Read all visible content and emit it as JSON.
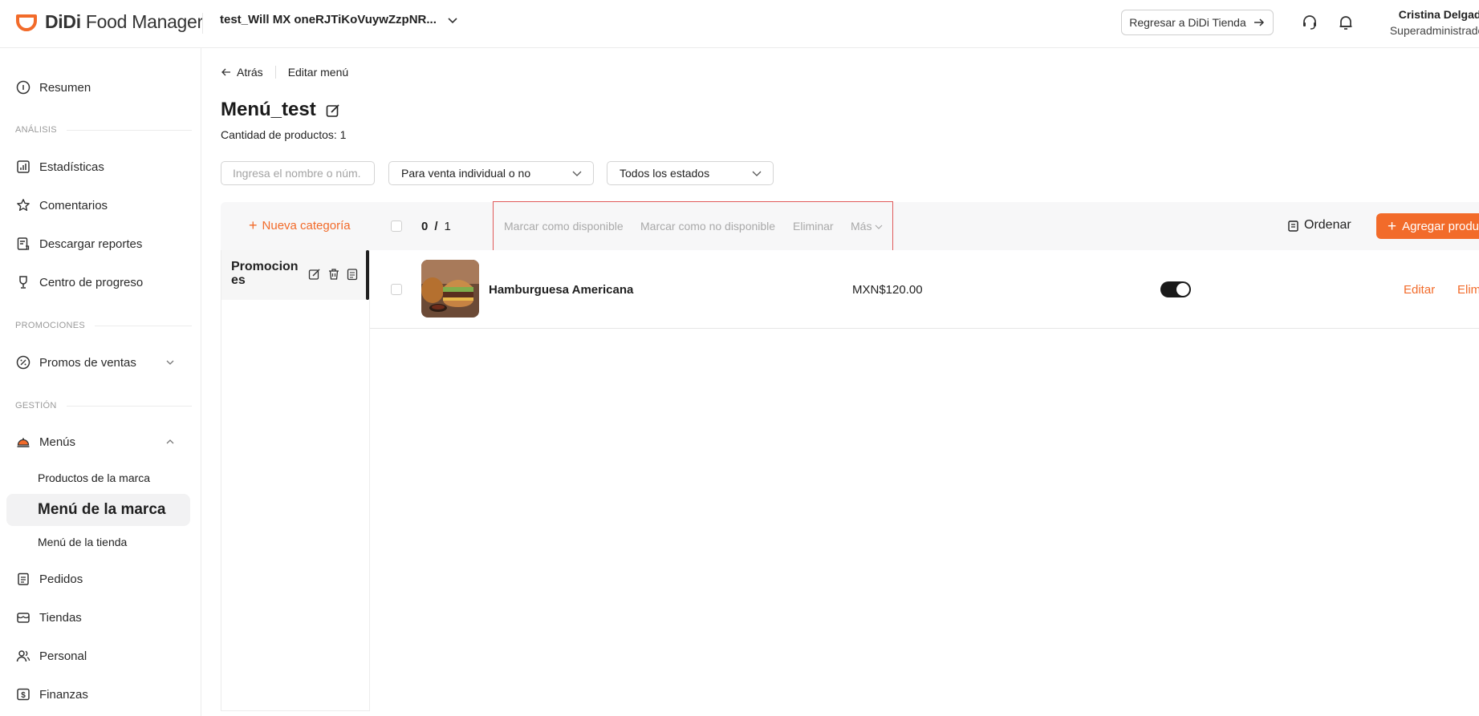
{
  "header": {
    "logo_brand": "DiDi",
    "logo_product": "Food Manager",
    "store_name": "test_Will MX oneRJTiKoVuywZzpNR...",
    "back_button": "Regresar a DiDi Tienda",
    "user_name": "Cristina Delgado",
    "user_role": "Superadministrador"
  },
  "sidebar": {
    "summary": "Resumen",
    "section_analysis": "ANÁLISIS",
    "stats": "Estadísticas",
    "comments": "Comentarios",
    "reports": "Descargar reportes",
    "progress": "Centro de progreso",
    "section_promos": "PROMOCIONES",
    "sales_promos": "Promos de ventas",
    "section_management": "GESTIÓN",
    "menus": "Menús",
    "brand_products": "Productos de la marca",
    "brand_menu": "Menú de la marca",
    "store_menu": "Menú de la tienda",
    "orders": "Pedidos",
    "stores": "Tiendas",
    "staff": "Personal",
    "finances": "Finanzas"
  },
  "breadcrumb": {
    "back": "Atrás",
    "current": "Editar menú"
  },
  "page": {
    "title": "Menú_test",
    "product_count": "Cantidad de productos: 1"
  },
  "filters": {
    "search_placeholder": "Ingresa el nombre o núm. d",
    "sale_type": "Para venta individual o no",
    "status": "Todos los estados"
  },
  "toolbar": {
    "new_category": "Nueva categoría",
    "selected": "0",
    "separator": "/",
    "total": "1",
    "mark_available": "Marcar como disponible",
    "mark_unavailable": "Marcar como no disponible",
    "delete": "Eliminar",
    "more": "Más",
    "sort": "Ordenar",
    "add_product": "Agregar producto"
  },
  "categories": [
    {
      "name": "Promociones"
    }
  ],
  "products": [
    {
      "name": "Hamburguesa Americana",
      "price": "MXN$120.00",
      "available": true,
      "edit": "Editar",
      "delete": "Eliminar"
    }
  ],
  "colors": {
    "accent": "#f26b2a",
    "highlight_box": "#e05a5a"
  }
}
